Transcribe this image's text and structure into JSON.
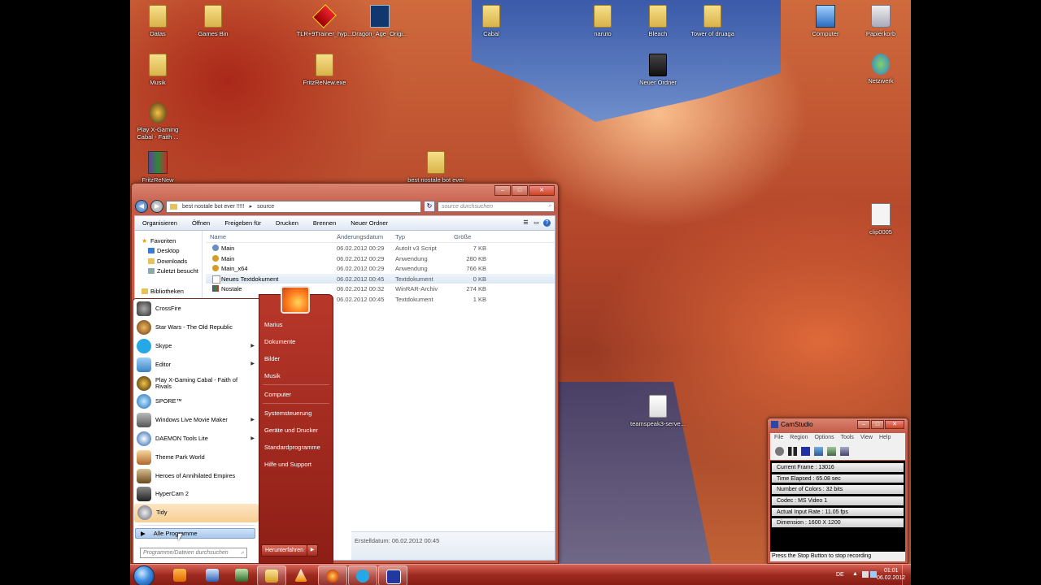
{
  "desktop": {
    "icons": [
      {
        "label": "Datas"
      },
      {
        "label": "Games Bin"
      },
      {
        "label": "TLR+9Trainer_hyp..."
      },
      {
        "label": "Dragon_Age_Origi..."
      },
      {
        "label": "Cabal"
      },
      {
        "label": "naruto"
      },
      {
        "label": "Bleach"
      },
      {
        "label": "Tower of druaga"
      },
      {
        "label": "Computer"
      },
      {
        "label": "Papierkorb"
      },
      {
        "label": "Musik"
      },
      {
        "label": "FritzReNew.exe"
      },
      {
        "label": "Neuer Ordner"
      },
      {
        "label": "Netzwerk"
      },
      {
        "label": "Play X-Gaming Cabal - Faith ..."
      },
      {
        "label": "FritzReNew"
      },
      {
        "label": "best nostale bot ever"
      },
      {
        "label": "clip0005"
      },
      {
        "label": "teamspeak3-serve..."
      }
    ]
  },
  "explorer": {
    "breadcrumb": [
      "best nostale bot ever !!!!!",
      "source"
    ],
    "search_placeholder": "source durchsuchen",
    "toolbar": [
      "Organisieren",
      "Öffnen",
      "Freigeben für",
      "Drucken",
      "Brennen",
      "Neuer Ordner"
    ],
    "nav": {
      "favorites": "Favoriten",
      "favorite_items": [
        "Desktop",
        "Downloads",
        "Zuletzt besucht"
      ],
      "libraries": "Bibliotheken"
    },
    "columns": {
      "name": "Name",
      "date": "Änderungsdatum",
      "type": "Typ",
      "size": "Größe"
    },
    "files": [
      {
        "name": "Main",
        "date": "06.02.2012 00:29",
        "type": "AutoIt v3 Script",
        "size": "7 KB"
      },
      {
        "name": "Main",
        "date": "06.02.2012 00:29",
        "type": "Anwendung",
        "size": "280 KB"
      },
      {
        "name": "Main_x64",
        "date": "06.02.2012 00:29",
        "type": "Anwendung",
        "size": "766 KB"
      },
      {
        "name": "Neues Textdokument",
        "date": "06.02.2012 00:45",
        "type": "Textdokument",
        "size": "0 KB"
      },
      {
        "name": "Nostale",
        "date": "06.02.2012 00:32",
        "type": "WinRAR-Archiv",
        "size": "274 KB"
      },
      {
        "name": "",
        "date": "06.02.2012 00:45",
        "type": "Textdokument",
        "size": "1 KB"
      }
    ],
    "details": "Erstelldatum: 06.02.2012 00:45"
  },
  "startmenu": {
    "programs": [
      {
        "label": "CrossFire"
      },
      {
        "label": "Star Wars - The Old Republic"
      },
      {
        "label": "Skype"
      },
      {
        "label": "Editor"
      },
      {
        "label": "Play X-Gaming Cabal - Faith of Rivals"
      },
      {
        "label": "SPORE™"
      },
      {
        "label": "Windows Live Movie Maker"
      },
      {
        "label": "DAEMON Tools Lite"
      },
      {
        "label": "Theme Park World"
      },
      {
        "label": "Heroes of Annihilated Empires"
      },
      {
        "label": "HyperCam 2"
      },
      {
        "label": "Tidy"
      }
    ],
    "all_programs": "Alle Programme",
    "search_placeholder": "Programme/Dateien durchsuchen",
    "right_links": [
      "Marius",
      "Dokumente",
      "Bilder",
      "Musik",
      "Computer",
      "Systemsteuerung",
      "Geräte und Drucker",
      "Standardprogramme",
      "Hilfe und Support"
    ],
    "shutdown": "Herunterfahren"
  },
  "camstudio": {
    "title": "CamStudio",
    "menu": [
      "File",
      "Region",
      "Options",
      "Tools",
      "View",
      "Help"
    ],
    "stats": [
      "Current Frame : 13016",
      "Time Elapsed : 65.08 sec",
      "Number of Colors : 32 bits",
      "Codec : MS Video 1",
      "Actual Input Rate : 11.05 fps",
      "Dimension : 1600 X 1200"
    ],
    "status": "Press the Stop Button to stop recording"
  },
  "taskbar": {
    "language": "DE",
    "time": "01:01",
    "date": "06.02.2012"
  }
}
